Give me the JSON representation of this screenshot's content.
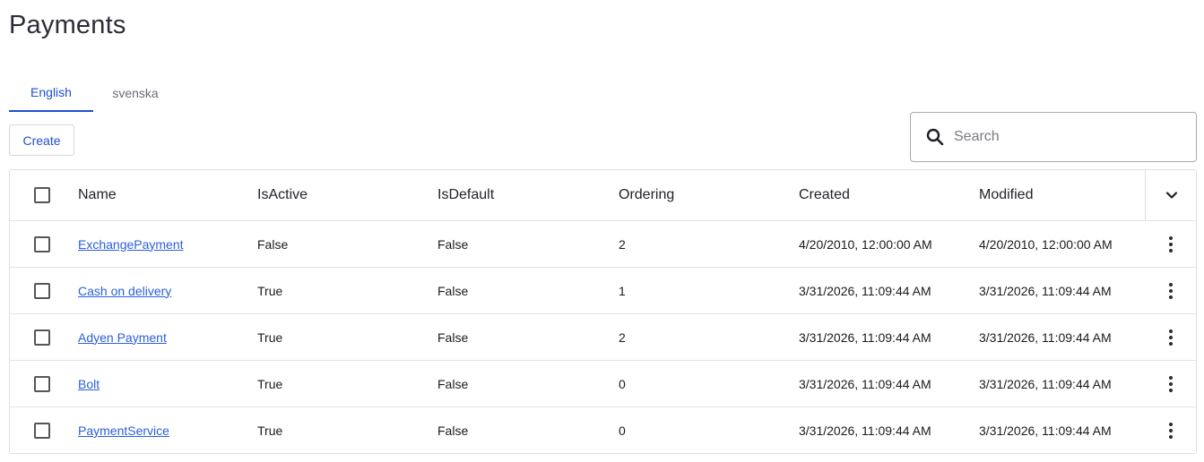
{
  "page": {
    "title": "Payments"
  },
  "tabs": [
    {
      "label": "English",
      "active": true
    },
    {
      "label": "svenska",
      "active": false
    }
  ],
  "toolbar": {
    "create_label": "Create"
  },
  "search": {
    "placeholder": "Search",
    "value": "",
    "icon": "search-icon"
  },
  "table": {
    "columns": {
      "name": "Name",
      "isactive": "IsActive",
      "isdefault": "IsDefault",
      "ordering": "Ordering",
      "created": "Created",
      "modified": "Modified"
    },
    "rows": [
      {
        "name": "ExchangePayment",
        "isactive": "False",
        "isdefault": "False",
        "ordering": "2",
        "created": "4/20/2010, 12:00:00 AM",
        "modified": "4/20/2010, 12:00:00 AM"
      },
      {
        "name": "Cash on delivery",
        "isactive": "True",
        "isdefault": "False",
        "ordering": "1",
        "created": "3/31/2026, 11:09:44 AM",
        "modified": "3/31/2026, 11:09:44 AM"
      },
      {
        "name": "Adyen Payment",
        "isactive": "True",
        "isdefault": "False",
        "ordering": "2",
        "created": "3/31/2026, 11:09:44 AM",
        "modified": "3/31/2026, 11:09:44 AM"
      },
      {
        "name": "Bolt",
        "isactive": "True",
        "isdefault": "False",
        "ordering": "0",
        "created": "3/31/2026, 11:09:44 AM",
        "modified": "3/31/2026, 11:09:44 AM"
      },
      {
        "name": "PaymentService",
        "isactive": "True",
        "isdefault": "False",
        "ordering": "0",
        "created": "3/31/2026, 11:09:44 AM",
        "modified": "3/31/2026, 11:09:44 AM"
      }
    ]
  },
  "colors": {
    "accent": "#1f4fd1",
    "link": "#2b5fd9",
    "border": "#e0e0e4"
  }
}
